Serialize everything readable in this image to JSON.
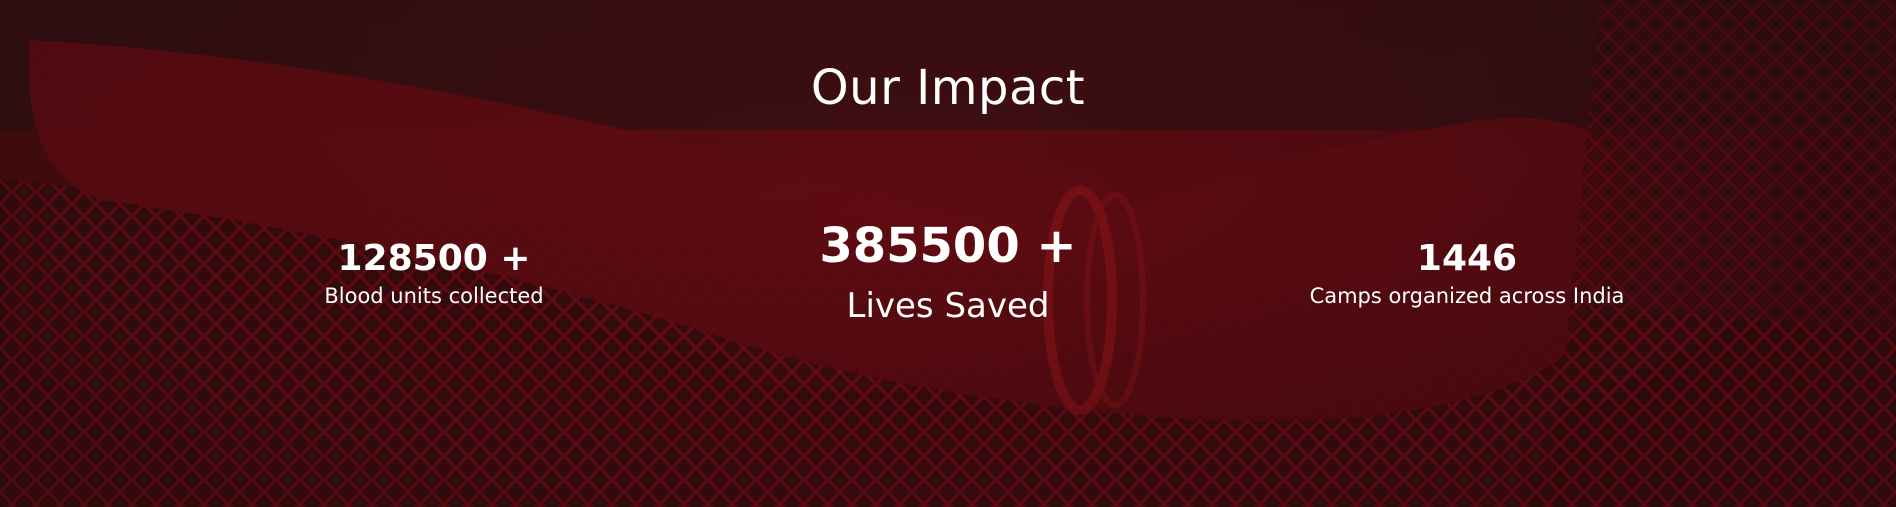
{
  "section": {
    "title": "Our Impact",
    "background_color": "#3a0d0f",
    "accent_color": "#8b0a12"
  },
  "stats": [
    {
      "value": "128500 +",
      "label": "Blood units collected"
    },
    {
      "value": "385500 +",
      "label": "Lives Saved"
    },
    {
      "value": "1446",
      "label": "Camps organized across India"
    }
  ]
}
